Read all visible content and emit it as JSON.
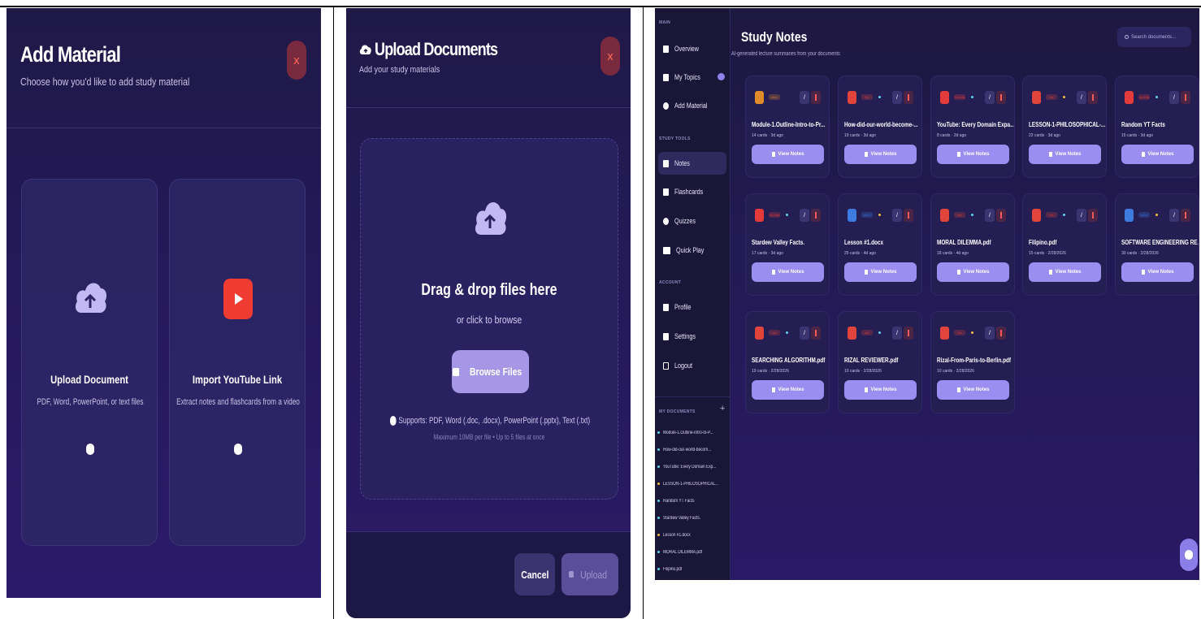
{
  "add_material": {
    "title": "Add Material",
    "subtitle": "Choose how you'd like to add study material",
    "close": "x",
    "options": [
      {
        "title": "Upload Document",
        "desc": "PDF, Word, PowerPoint, or text files",
        "icon": "cloud-upload-icon"
      },
      {
        "title": "Import YouTube Link",
        "desc": "Extract notes and flashcards from a video",
        "icon": "youtube-icon"
      }
    ]
  },
  "upload": {
    "title": "Upload Documents",
    "subtitle": "Add your study materials",
    "close": "x",
    "drop_title": "Drag & drop files here",
    "drop_sub": "or click to browse",
    "browse": "Browse Files",
    "supports": "Supports: PDF, Word (.doc, .docx), PowerPoint (.pptx), Text (.txt)",
    "limit": "Maximum 10MB per file • Up to 5 files at once",
    "cancel": "Cancel",
    "upload": "Upload"
  },
  "app": {
    "sidebar": {
      "main_label": "MAIN",
      "main": [
        "Overview",
        "My Topics",
        "Add Material"
      ],
      "tools_label": "STUDY TOOLS",
      "tools": [
        "Notes",
        "Flashcards",
        "Quizzes",
        "Quick Play"
      ],
      "account_label": "ACCOUNT",
      "account": [
        "Profile",
        "Settings",
        "Logout"
      ],
      "docs_label": "MY DOCUMENTS",
      "docs_add": "+",
      "docs": [
        "Module-1.Outline-Intro-to-P...",
        "How-did-our-world-becom...",
        "YouTube: Every Domain Exp...",
        "LESSON-1-PHILOSOPHICAL...",
        "Random YT Facts",
        "Stardew Valley Facts.",
        "Lesson #1.docx",
        "MORAL DILEMMA.pdf",
        "Filipino.pdf"
      ]
    },
    "title": "Study Notes",
    "subtitle": "AI-generated lecture summaries from your documents",
    "search_placeholder": "Search documents...",
    "view_label": "View Notes",
    "notes": [
      {
        "title": "Module-1.Outline-Intro-to-Pr...",
        "tag": "PPTX",
        "meta": "14 cards · 3d ago",
        "color": "#e08a2a"
      },
      {
        "title": "How-did-our-world-become-...",
        "tag": "PDF",
        "meta": "19 cards · 3d ago",
        "color": "#e0443a"
      },
      {
        "title": "YouTube: Every Domain Expa...",
        "tag": "YOUTUBE",
        "meta": "8 cards · 2d ago",
        "color": "#e33b3b"
      },
      {
        "title": "LESSON-1-PHILOSOPHICAL-...",
        "tag": "PDF",
        "meta": "22 cards · 3d ago",
        "color": "#e0443a"
      },
      {
        "title": "Random YT Facts",
        "tag": "YOUTUBE",
        "meta": "15 cards · 3d ago",
        "color": "#e33b3b"
      },
      {
        "title": "Stardew Valley Facts.",
        "tag": "YOUTUBE",
        "meta": "17 cards · 3d ago",
        "color": "#e33b3b"
      },
      {
        "title": "Lesson #1.docx",
        "tag": "DOCX",
        "meta": "25 cards · 4d ago",
        "color": "#3d7be0"
      },
      {
        "title": "MORAL DILEMMA.pdf",
        "tag": "PDF",
        "meta": "18 cards · 4d ago",
        "color": "#e0443a"
      },
      {
        "title": "Filipino.pdf",
        "tag": "PDF",
        "meta": "15 cards · 2/28/2026",
        "color": "#e0443a"
      },
      {
        "title": "SOFTWARE ENGINEERING RE...",
        "tag": "DOCX",
        "meta": "30 cards · 2/28/2026",
        "color": "#3d7be0"
      },
      {
        "title": "SEARCHING ALGORITHM.pdf",
        "tag": "PDF",
        "meta": "19 cards · 2/28/2026",
        "color": "#e0443a"
      },
      {
        "title": "RIZAL REVIEWER.pdf",
        "tag": "PDF",
        "meta": "10 cards · 2/28/2026",
        "color": "#e0443a"
      },
      {
        "title": "Rizal-From-Paris-to-Berlin.pdf",
        "tag": "PDF",
        "meta": "10 cards · 2/28/2026",
        "color": "#e0443a"
      }
    ]
  }
}
